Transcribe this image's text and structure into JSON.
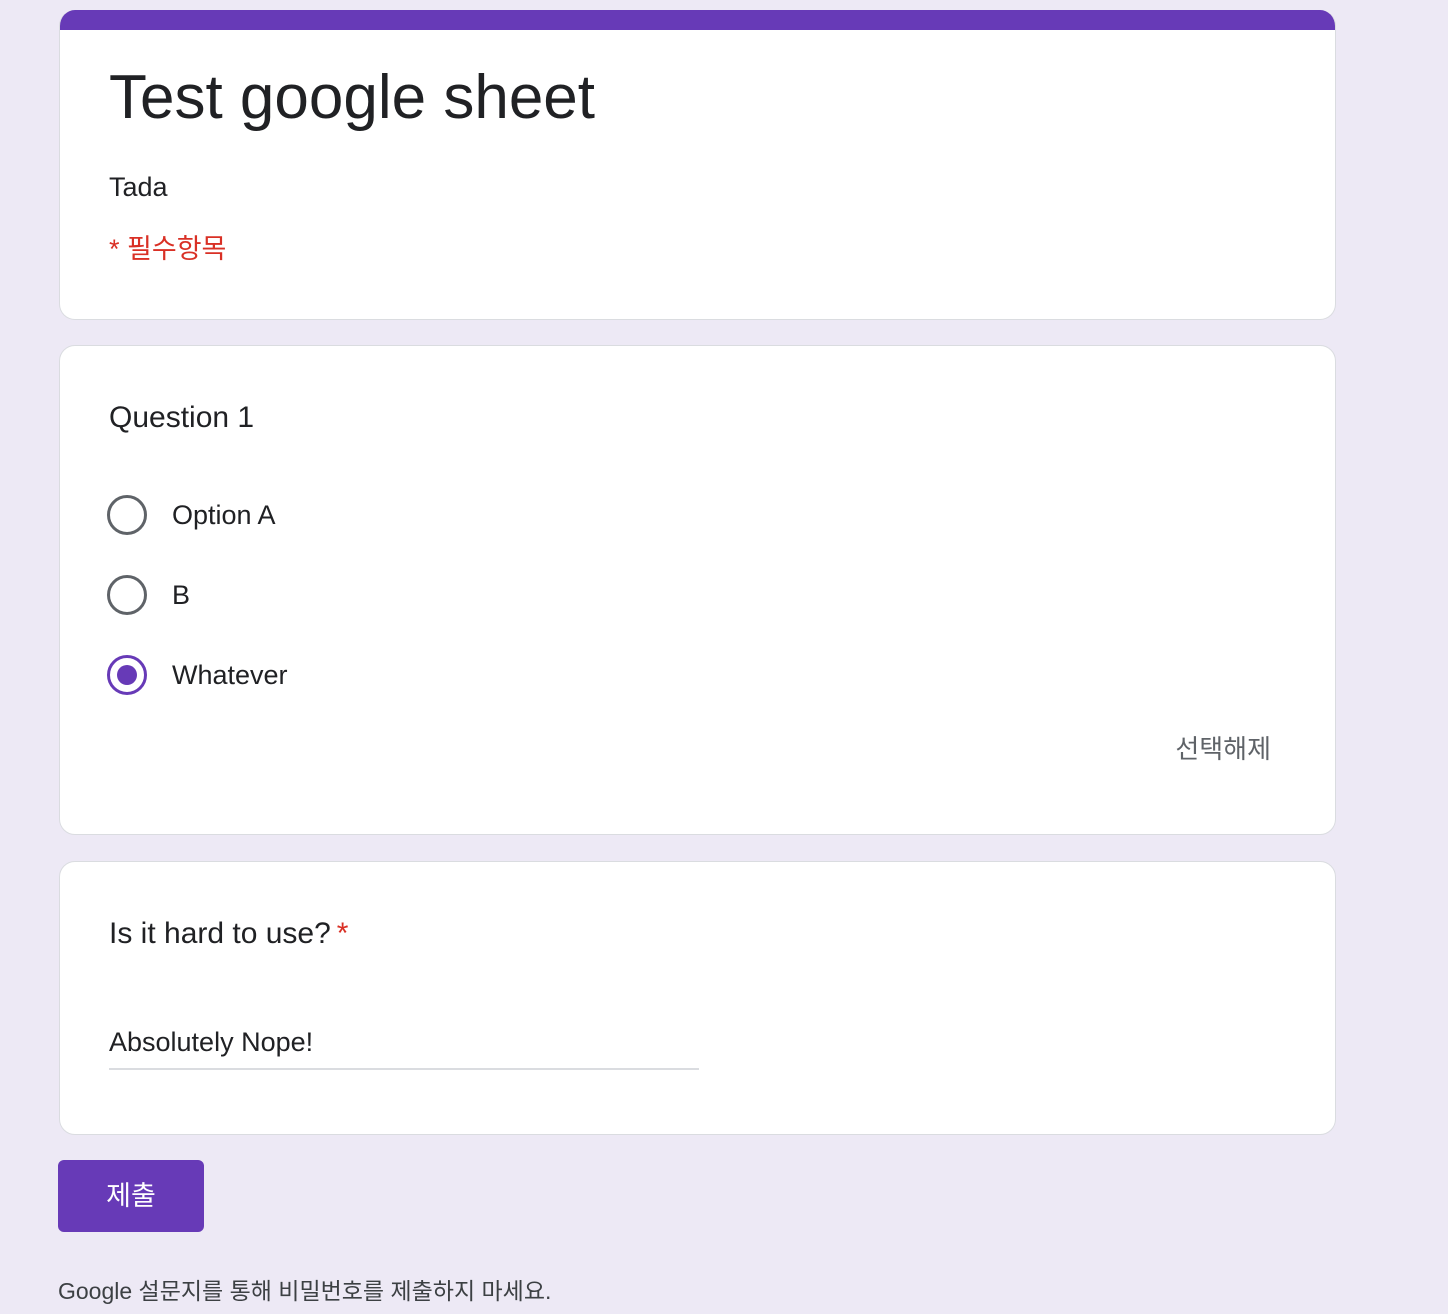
{
  "colors": {
    "accent": "#673ab7",
    "required": "#d93025",
    "background": "#ede9f5"
  },
  "form": {
    "title": "Test google sheet",
    "description": "Tada",
    "required_note": "* 필수항목"
  },
  "question1": {
    "title": "Question 1",
    "options": [
      {
        "label": "Option A",
        "selected": false
      },
      {
        "label": "B",
        "selected": false
      },
      {
        "label": "Whatever",
        "selected": true
      }
    ],
    "clear_label": "선택해제"
  },
  "question2": {
    "title": "Is it hard to use?",
    "required_marker": "*",
    "answer": "Absolutely Nope!"
  },
  "submit_label": "제출",
  "footer_note": "Google 설문지를 통해 비밀번호를 제출하지 마세요."
}
